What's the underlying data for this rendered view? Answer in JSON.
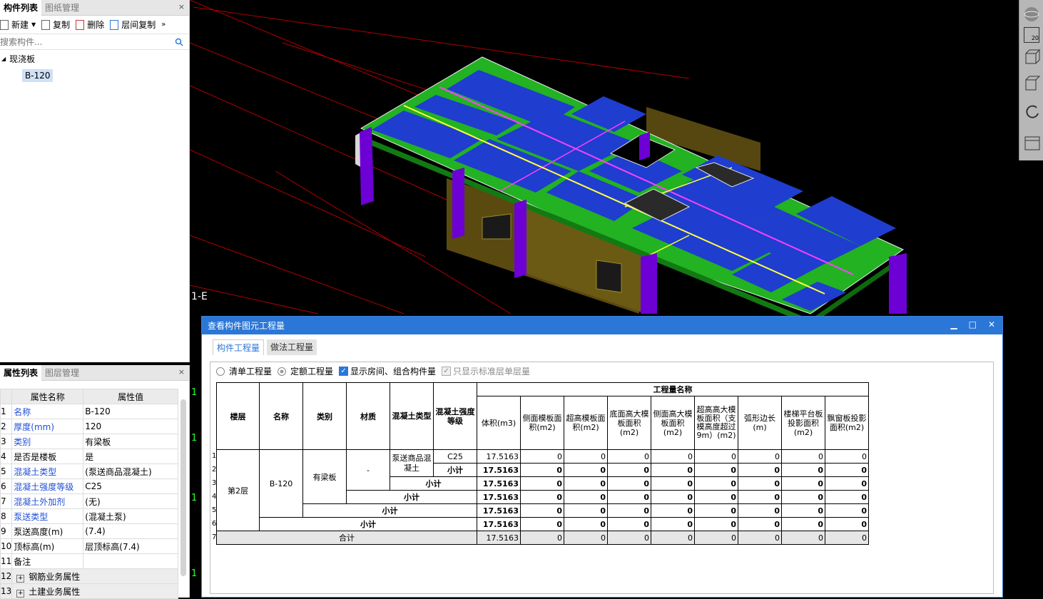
{
  "comp_panel": {
    "tab_active": "构件列表",
    "tab_other": "图纸管理",
    "close": "×",
    "toolbar": {
      "new": "新建",
      "copy": "复制",
      "delete": "删除",
      "floor_copy": "层间复制",
      "more": "»"
    },
    "search_placeholder": "搜索构件...",
    "tree": {
      "category": "现浇板",
      "expander": "◢",
      "item": "B-120"
    }
  },
  "attr_panel": {
    "tab_active": "属性列表",
    "tab_other": "图层管理",
    "close": "×",
    "header_name": "属性名称",
    "header_value": "属性值",
    "rows": [
      {
        "n": "1",
        "name": "名称",
        "value": "B-120"
      },
      {
        "n": "2",
        "name": "厚度(mm)",
        "value": "120"
      },
      {
        "n": "3",
        "name": "类别",
        "value": "有梁板"
      },
      {
        "n": "4",
        "name": "是否是楼板",
        "value": "是"
      },
      {
        "n": "5",
        "name": "混凝土类型",
        "value": "(泵送商品混凝土)"
      },
      {
        "n": "6",
        "name": "混凝土强度等级",
        "value": "C25"
      },
      {
        "n": "7",
        "name": "混凝土外加剂",
        "value": "(无)"
      },
      {
        "n": "8",
        "name": "泵送类型",
        "value": "(混凝土泵)"
      },
      {
        "n": "9",
        "name": "泵送高度(m)",
        "value": "(7.4)"
      },
      {
        "n": "10",
        "name": "顶标高(m)",
        "value": "层顶标高(7.4)"
      },
      {
        "n": "11",
        "name": "备注",
        "value": ""
      },
      {
        "n": "12",
        "name": "钢筋业务属性",
        "value": ""
      },
      {
        "n": "13",
        "name": "土建业务属性",
        "value": ""
      }
    ],
    "expand": "+"
  },
  "viewport": {
    "axis_label": "1-E",
    "side_marks": [
      "1",
      "1",
      "1",
      "1"
    ],
    "scale": "20"
  },
  "dialog": {
    "title": "查看构件图元工程量",
    "ctl": {
      "min": "▁",
      "max": "□",
      "close": "✕"
    },
    "tabs": [
      "构件工程量",
      "做法工程量"
    ],
    "opts": {
      "qd": "清单工程量",
      "de": "定额工程量",
      "show_room": "显示房间、组合构件量",
      "std_floor": "只显示标准层单层量"
    },
    "table": {
      "h": {
        "floor": "楼层",
        "name": "名称",
        "category": "类别",
        "material": "材质",
        "conc_type": "混凝土类型",
        "conc_grade": "混凝土强度等级",
        "group": "工程量名称",
        "cols": [
          "体积(m3)",
          "侧面模板面积(m2)",
          "超高模板面积(m2)",
          "底面高大模板面积(m2)",
          "侧面高大模板面积(m2)",
          "超高高大模板面积（支模高度超过9m）(m2)",
          "弧形边长(m)",
          "楼梯平台板投影面积(m2)",
          "飘窗板投影面积(m2)"
        ]
      },
      "floor": "第2层",
      "name": "B-120",
      "category": "有梁板",
      "material": "-",
      "conc_type": "泵送商品混凝土",
      "conc_grade": "C25",
      "subtotal": "小计",
      "total": "合计",
      "rows": [
        [
          "17.5163",
          "0",
          "0",
          "0",
          "0",
          "0",
          "0",
          "0",
          "0"
        ],
        [
          "17.5163",
          "0",
          "0",
          "0",
          "0",
          "0",
          "0",
          "0",
          "0"
        ],
        [
          "17.5163",
          "0",
          "0",
          "0",
          "0",
          "0",
          "0",
          "0",
          "0"
        ],
        [
          "17.5163",
          "0",
          "0",
          "0",
          "0",
          "0",
          "0",
          "0",
          "0"
        ],
        [
          "17.5163",
          "0",
          "0",
          "0",
          "0",
          "0",
          "0",
          "0",
          "0"
        ],
        [
          "17.5163",
          "0",
          "0",
          "0",
          "0",
          "0",
          "0",
          "0",
          "0"
        ],
        [
          "17.5163",
          "0",
          "0",
          "0",
          "0",
          "0",
          "0",
          "0",
          "0"
        ]
      ],
      "row_nums": [
        "1",
        "2",
        "3",
        "4",
        "5",
        "6",
        "7"
      ]
    }
  }
}
